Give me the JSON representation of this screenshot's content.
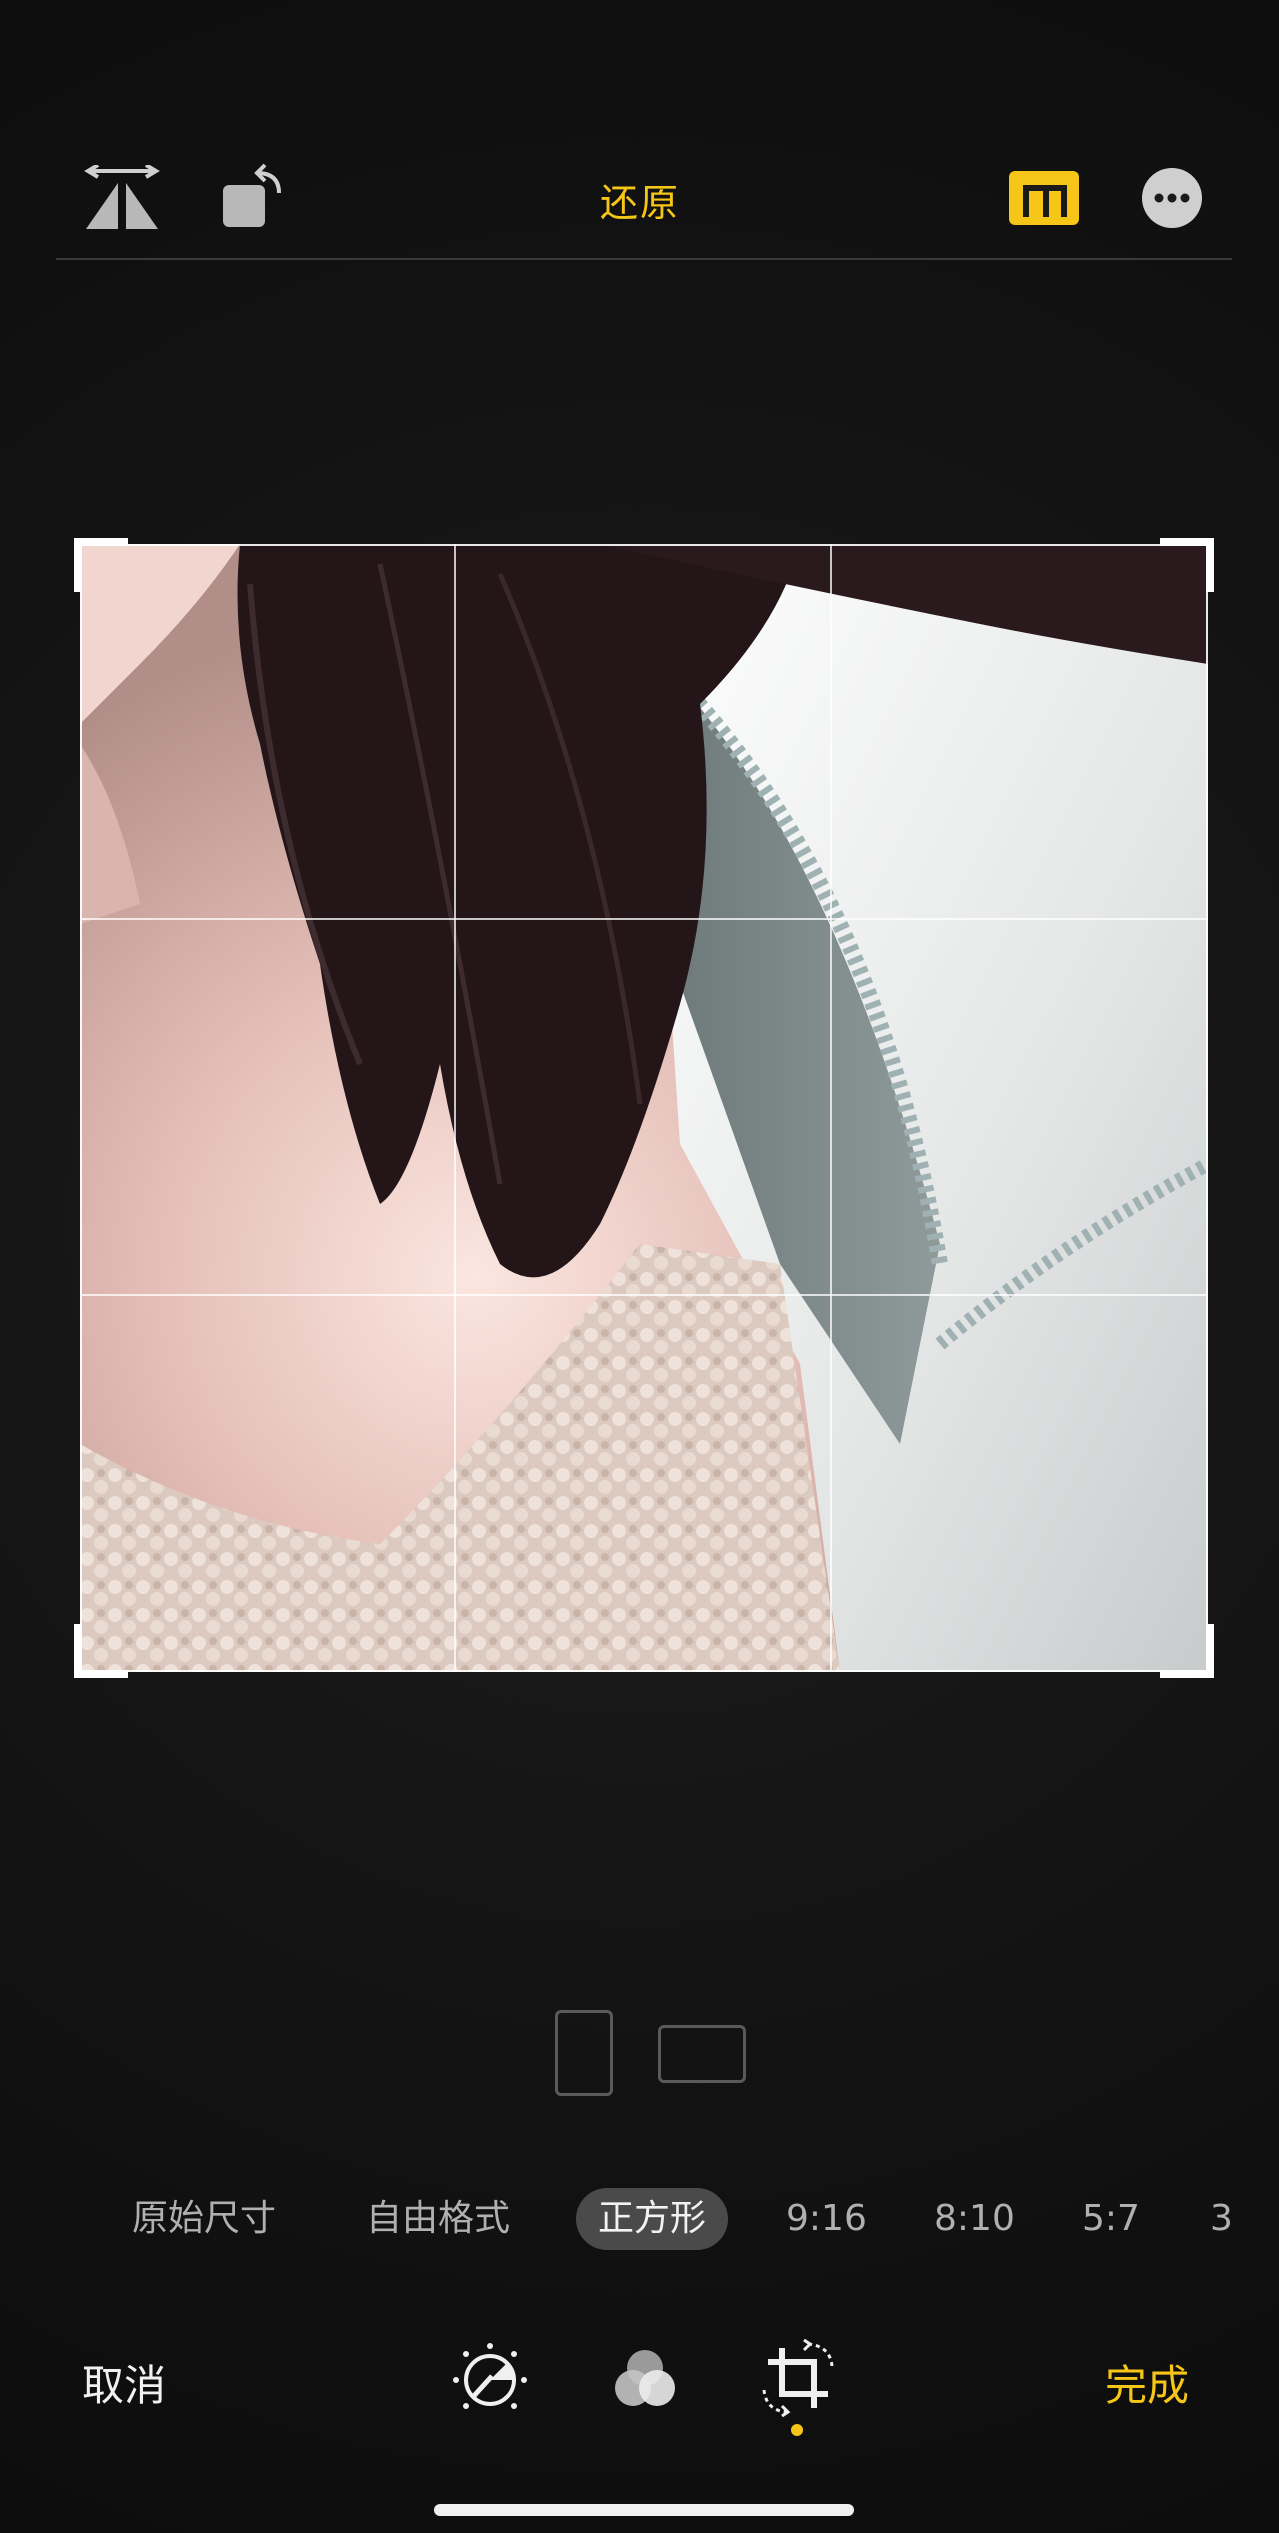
{
  "toolbar": {
    "flip_icon": "flip-horizontal-icon",
    "rotate_icon": "rotate-icon",
    "reset_label": "还原",
    "aspect_icon": "aspect-ratio-icon",
    "more_icon": "more-icon"
  },
  "crop": {
    "image_description_icon": "photo",
    "grid": "rule-of-thirds"
  },
  "orientation": {
    "portrait_icon": "portrait-orientation-icon",
    "landscape_icon": "landscape-orientation-icon"
  },
  "ratios": [
    {
      "label": "原始尺寸",
      "selected": false
    },
    {
      "label": "自由格式",
      "selected": false
    },
    {
      "label": "正方形",
      "selected": true
    },
    {
      "label": "9:16",
      "selected": false
    },
    {
      "label": "8:10",
      "selected": false
    },
    {
      "label": "5:7",
      "selected": false
    },
    {
      "label": "3",
      "selected": false
    }
  ],
  "bottom": {
    "cancel_label": "取消",
    "done_label": "完成",
    "tools": [
      "adjust-icon",
      "filters-icon",
      "crop-rotate-icon"
    ],
    "active_tool": "crop-rotate-icon"
  },
  "colors": {
    "accent": "#f5c518",
    "background": "#111111",
    "text": "#dcdcdc"
  }
}
